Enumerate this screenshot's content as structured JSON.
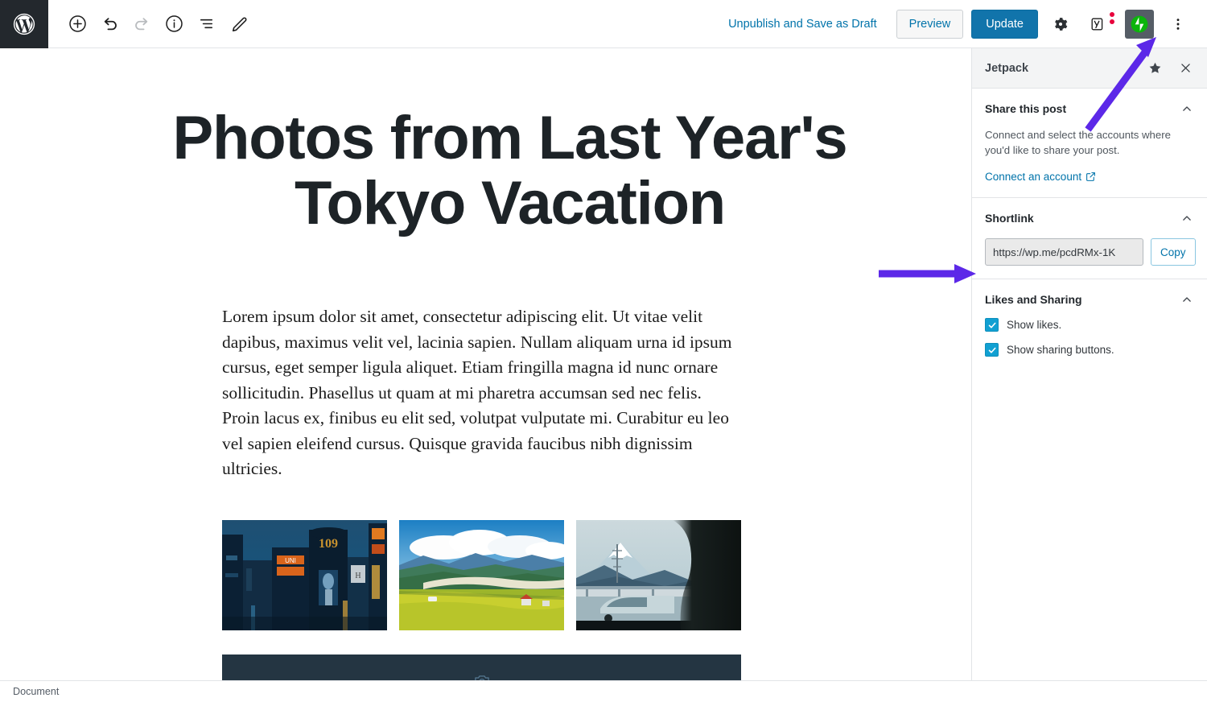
{
  "meta": {
    "accent_blue": "#0073aa",
    "update_button_bg": "#1174ab",
    "arrow_purple": "#5C28E8",
    "jetpack_green": "#0bb40b",
    "checkbox_blue": "#11a0d2",
    "sidebar_header_bg": "#f3f4f5"
  },
  "toolbar": {
    "logo_name": "WordPress",
    "left_tools": [
      {
        "name": "add-block-button",
        "icon": "plus-circle-icon",
        "label": "Add block",
        "disabled": false
      },
      {
        "name": "undo-button",
        "icon": "undo-icon",
        "label": "Undo",
        "disabled": false
      },
      {
        "name": "redo-button",
        "icon": "redo-icon",
        "label": "Redo",
        "disabled": true
      },
      {
        "name": "content-structure-button",
        "icon": "info-circle-icon",
        "label": "Content structure",
        "disabled": false
      },
      {
        "name": "block-navigation-button",
        "icon": "list-view-icon",
        "label": "Block navigation",
        "disabled": false
      },
      {
        "name": "edit-mode-button",
        "icon": "pencil-icon",
        "label": "Edit",
        "disabled": false
      }
    ],
    "unpublish_label": "Unpublish and Save as Draft",
    "preview_label": "Preview",
    "update_label": "Update",
    "settings_icon": "gear-icon",
    "yoast_icon": "yoast-seo-icon",
    "jetpack_icon": "jetpack-bolt-icon",
    "more_icon": "kebab-menu-icon"
  },
  "post": {
    "title": "Photos from Last Year's Tokyo Vacation",
    "paragraph": "Lorem ipsum dolor sit amet, consectetur adipiscing elit. Ut vitae velit dapibus, maximus velit vel, lacinia sapien. Nullam aliquam urna id ipsum cursus, eget semper ligula aliquet. Etiam fringilla magna id nunc ornare sollicitudin. Phasellus ut quam at mi pharetra accumsan sed nec felis. Proin lacus ex, finibus eu elit sed, volutpat vulputate mi. Curabitur eu leo vel sapien eleifend cursus. Quisque gravida faucibus nibh dignissim ultricies.",
    "gallery": [
      {
        "name": "gallery-image-shibuya-night",
        "alt": "Shibuya 109 building at night with neon signs"
      },
      {
        "name": "gallery-image-countryside",
        "alt": "Green rice fields and mountains under clouds"
      },
      {
        "name": "gallery-image-mount-fuji",
        "alt": "Mount Fuji seen from a moving train window"
      }
    ],
    "wide_block": {
      "name": "wide-media-block",
      "alt": "Dark wide image block partially scrolled off screen"
    }
  },
  "sidebar": {
    "title": "Jetpack",
    "star_icon": "star-icon",
    "close_icon": "close-icon",
    "sections": [
      {
        "id": "share",
        "title": "Share this post",
        "collapse_icon": "chevron-up-icon",
        "description": "Connect and select the accounts where you'd like to share your post.",
        "link_label": "Connect an account",
        "link_icon": "external-link-icon"
      },
      {
        "id": "shortlink",
        "title": "Shortlink",
        "collapse_icon": "chevron-up-icon",
        "value": "https://wp.me/pcdRMx-1K",
        "placeholder": "https://wp.me/pcdRMx-1K",
        "copy_label": "Copy"
      },
      {
        "id": "likes",
        "title": "Likes and Sharing",
        "collapse_icon": "chevron-up-icon",
        "checkboxes": [
          {
            "label": "Show likes.",
            "checked": true,
            "name": "show-likes-checkbox"
          },
          {
            "label": "Show sharing buttons.",
            "checked": true,
            "name": "show-sharing-buttons-checkbox"
          }
        ]
      }
    ]
  },
  "statusbar": {
    "breadcrumb": "Document"
  },
  "annotations": [
    {
      "name": "arrow-to-jetpack-button",
      "type": "diagonal-arrow",
      "color": "#5C28E8"
    },
    {
      "name": "arrow-to-shortlink-field",
      "type": "horizontal-arrow",
      "color": "#5C28E8"
    }
  ]
}
